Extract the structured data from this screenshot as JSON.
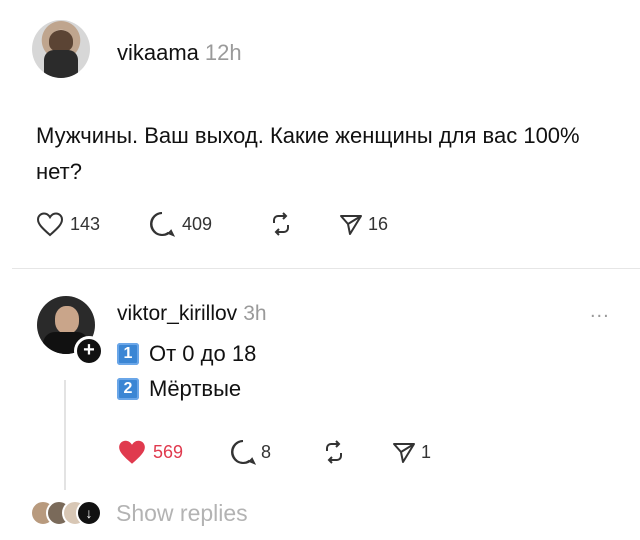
{
  "post1": {
    "username": "vikaama",
    "time": "12h",
    "text": "Мужчины. Ваш выход. Какие женщины для вас 100% нет?",
    "likes": "143",
    "comments": "409",
    "shares": "16"
  },
  "post2": {
    "username": "viktor_kirillov",
    "time": "3h",
    "more": "...",
    "line1_key": "1",
    "line1_text": "От 0 до 18",
    "line2_key": "2",
    "line2_text": "Мёртвые",
    "likes": "569",
    "comments": "8",
    "shares": "1",
    "follow_symbol": "+"
  },
  "replies": {
    "label": "Show replies"
  },
  "colors": {
    "like_active": "#e03a4e",
    "muted": "#9a9a9a",
    "keycap": "#3b86d4"
  },
  "icons": [
    "heart-icon",
    "comment-icon",
    "repost-icon",
    "send-icon",
    "more-icon",
    "follow-plus-icon"
  ]
}
